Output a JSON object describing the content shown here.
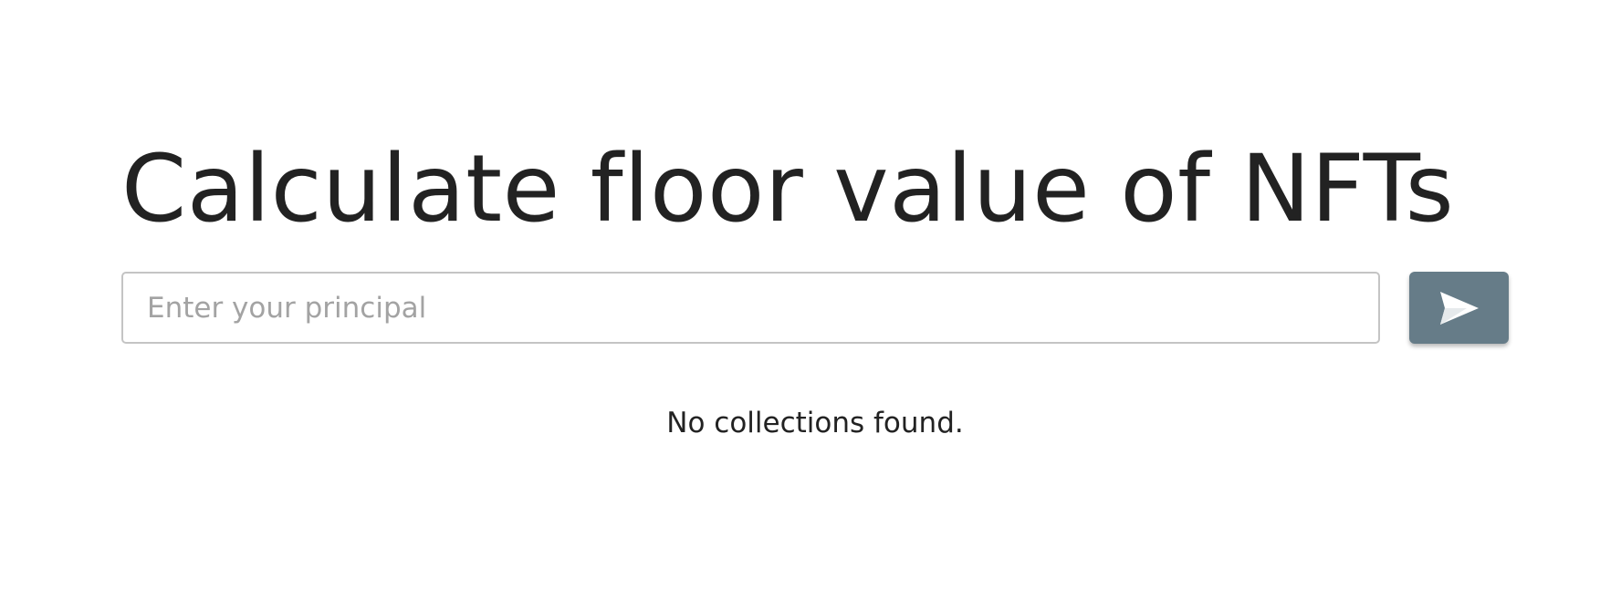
{
  "header": {
    "title": "Calculate floor value of NFTs"
  },
  "search": {
    "placeholder": "Enter your principal",
    "value": "",
    "submit_icon": "send-icon",
    "submit_color": "#667c88"
  },
  "results": {
    "empty_message": "No collections found."
  }
}
